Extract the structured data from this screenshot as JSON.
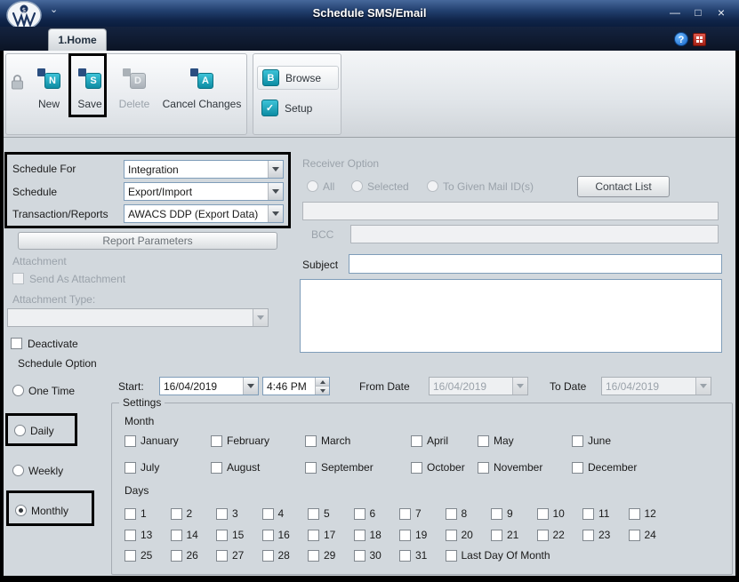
{
  "window": {
    "title": "Schedule SMS/Email",
    "minimize_glyph": "—",
    "maximize_glyph": "□",
    "close_glyph": "×",
    "quick_access_glyph": "⌄",
    "help_glyph": "?"
  },
  "tab": {
    "home": "1.Home"
  },
  "ribbon": {
    "new_label": "New",
    "save_label": "Save",
    "delete_label": "Delete",
    "cancel_changes_label": "Cancel Changes",
    "browse_label": "Browse",
    "setup_label": "Setup",
    "icons": {
      "new": "N",
      "save": "S",
      "delete": "D",
      "cancel_changes": "A",
      "browse": "B",
      "setup": "✓"
    }
  },
  "schedule": {
    "schedule_for_label": "Schedule For",
    "schedule_for_value": "Integration",
    "schedule_label": "Schedule",
    "schedule_value": "Export/Import",
    "transaction_label": "Transaction/Reports",
    "transaction_value": "AWACS DDP (Export Data)",
    "report_parameters_label": "Report Parameters"
  },
  "receiver": {
    "title": "Receiver Option",
    "all_label": "All",
    "selected_label": "Selected",
    "to_given_label": "To Given Mail ID(s)",
    "contact_list_label": "Contact List",
    "bcc_label": "BCC",
    "mail_ids_value": "",
    "bcc_value": ""
  },
  "attachment": {
    "title": "Attachment",
    "send_as_label": "Send As Attachment",
    "type_label": "Attachment Type:",
    "type_value": ""
  },
  "message": {
    "subject_label": "Subject",
    "subject_value": "",
    "body_value": ""
  },
  "options": {
    "deactivate_label": "Deactivate",
    "schedule_option_label": "Schedule Option",
    "one_time_label": "One Time",
    "daily_label": "Daily",
    "weekly_label": "Weekly",
    "monthly_label": "Monthly",
    "selected_option": "Monthly"
  },
  "dates": {
    "start_label": "Start:",
    "start_date": "16/04/2019",
    "start_time": "4:46 PM",
    "from_label": "From Date",
    "from_date": "16/04/2019",
    "to_label": "To Date",
    "to_date": "16/04/2019"
  },
  "settings": {
    "title": "Settings",
    "month_label": "Month",
    "months": [
      "January",
      "February",
      "March",
      "April",
      "May",
      "June",
      "July",
      "August",
      "September",
      "October",
      "November",
      "December"
    ],
    "days_label": "Days",
    "days": [
      "1",
      "2",
      "3",
      "4",
      "5",
      "6",
      "7",
      "8",
      "9",
      "10",
      "11",
      "12",
      "13",
      "14",
      "15",
      "16",
      "17",
      "18",
      "19",
      "20",
      "21",
      "22",
      "23",
      "24",
      "25",
      "26",
      "27",
      "28",
      "29",
      "30",
      "31"
    ],
    "last_day_label": "Last Day Of Month"
  },
  "colors": {
    "titlebar_navy": "#16294e",
    "accent_teal": "#15a0b6",
    "form_bg": "#d2d8dd",
    "highlight_border": "#000000",
    "help_blue": "#1565c8",
    "red_icon": "#b52a1e"
  }
}
